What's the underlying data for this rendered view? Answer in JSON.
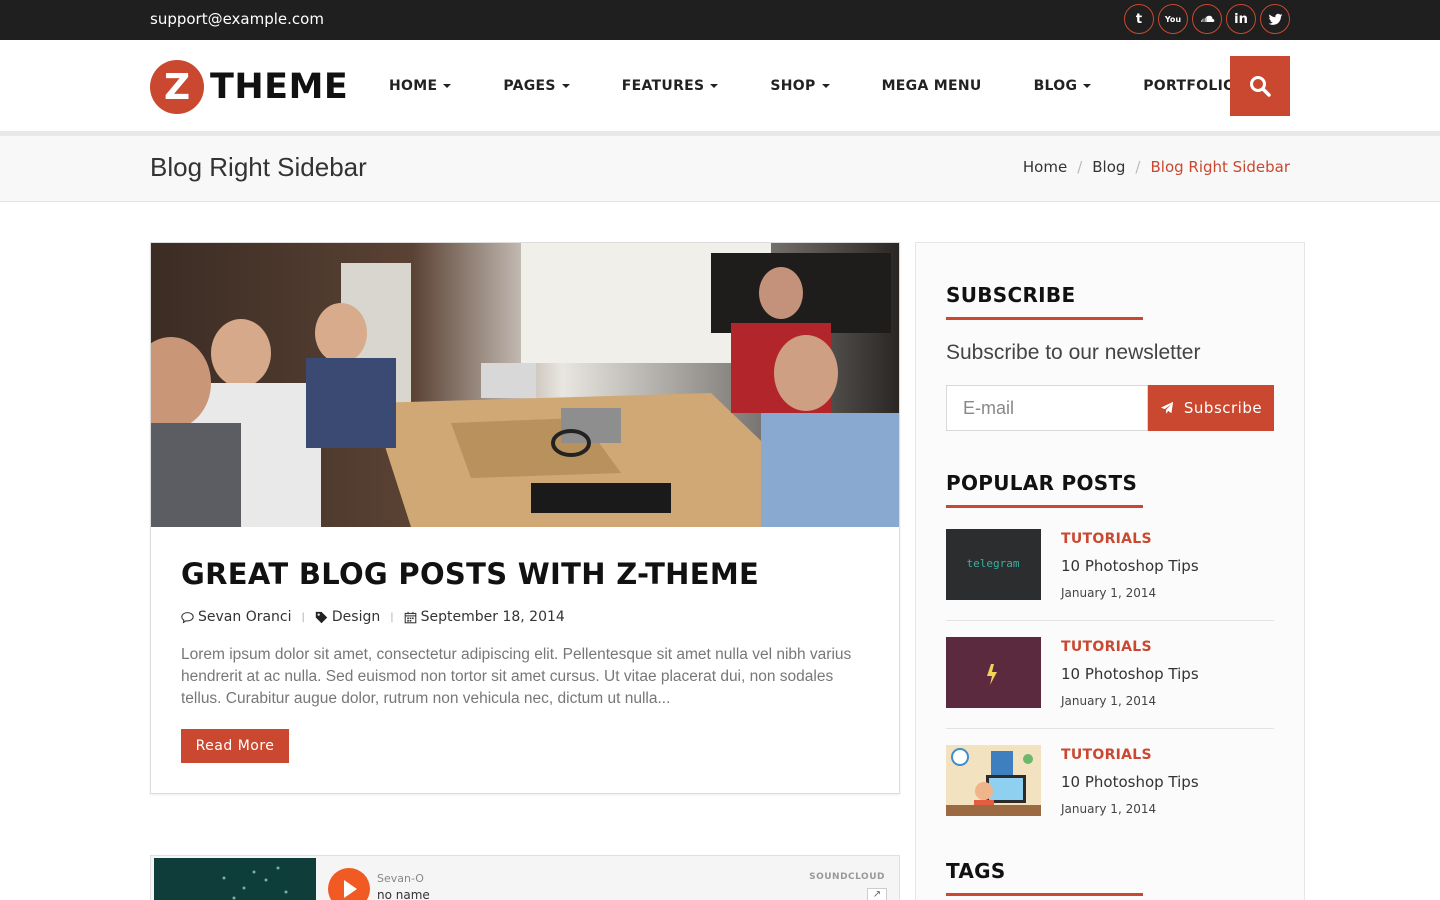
{
  "topbar": {
    "email": "support@example.com",
    "social": [
      {
        "icon": "tumblr-icon",
        "glyph": "t"
      },
      {
        "icon": "youtube-icon",
        "glyph": "You"
      },
      {
        "icon": "soundcloud-icon",
        "glyph": ""
      },
      {
        "icon": "linkedin-icon",
        "glyph": "in"
      },
      {
        "icon": "twitter-icon",
        "glyph": ""
      }
    ]
  },
  "header": {
    "logo_letter": "Z",
    "logo_word": "THEME",
    "nav": [
      {
        "label": "HOME",
        "dropdown": true
      },
      {
        "label": "PAGES",
        "dropdown": true
      },
      {
        "label": "FEATURES",
        "dropdown": true
      },
      {
        "label": "SHOP",
        "dropdown": true
      },
      {
        "label": "MEGA MENU",
        "dropdown": false
      },
      {
        "label": "BLOG",
        "dropdown": true
      },
      {
        "label": "PORTFOLIO",
        "dropdown": true
      }
    ],
    "search_icon": "search-icon"
  },
  "page": {
    "title": "Blog Right Sidebar",
    "breadcrumb": [
      "Home",
      "Blog",
      "Blog Right Sidebar"
    ]
  },
  "post": {
    "title": "GREAT BLOG POSTS WITH Z-THEME",
    "author": "Sevan Oranci",
    "category": "Design",
    "date": "September 18, 2014",
    "excerpt": "Lorem ipsum dolor sit amet, consectetur adipiscing elit. Pellentesque sit amet nulla vel nibh varius hendrerit at ac nulla. Sed euismod non tortor sit amet cursus. Ut vitae placerat dui, non sodales tellus. Curabitur augue dolor, rutrum non vehicula nec, dictum ut nulla...",
    "read_more": "Read More"
  },
  "soundcloud": {
    "user": "Sevan-O",
    "track": "no name",
    "brand": "SOUNDCLOUD"
  },
  "sidebar": {
    "subscribe": {
      "title": "SUBSCRIBE",
      "text": "Subscribe to our newsletter",
      "placeholder": "E-mail",
      "button": "Subscribe"
    },
    "popular": {
      "title": "POPULAR POSTS",
      "items": [
        {
          "category": "TUTORIALS",
          "title": "10 Photoshop Tips",
          "date": "January 1, 2014",
          "thumb_text": "telegram"
        },
        {
          "category": "TUTORIALS",
          "title": "10 Photoshop Tips",
          "date": "January 1, 2014"
        },
        {
          "category": "TUTORIALS",
          "title": "10 Photoshop Tips",
          "date": "January 1, 2014"
        }
      ]
    },
    "tags": {
      "title": "TAGS"
    }
  },
  "colors": {
    "accent": "#c9482f",
    "topbar": "#1f1f1f"
  }
}
